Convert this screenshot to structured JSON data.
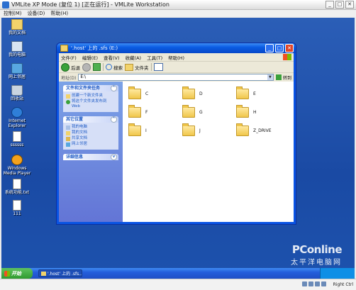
{
  "host": {
    "title": "VMLite XP Mode (复位 1) [正在运行] - VMLite Workstation",
    "menu": [
      "控制(M)",
      "设备(D)",
      "帮助(H)"
    ],
    "controls": [
      "_",
      "□",
      "✕"
    ],
    "status_text": "Right Ctrl"
  },
  "desktop_icons": [
    {
      "label": "我的文档",
      "icon": "my-documents-icon"
    },
    {
      "label": "我的电脑",
      "icon": "my-computer-icon"
    },
    {
      "label": "网上邻居",
      "icon": "network-places-icon"
    },
    {
      "label": "回收站",
      "icon": "recycle-bin-icon"
    },
    {
      "label": "Internet Explorer",
      "icon": "internet-explorer-icon"
    },
    {
      "label": "ssssss",
      "icon": "file-icon"
    },
    {
      "label": "Windows Media Player",
      "icon": "media-player-icon"
    },
    {
      "label": "系统功能.txt",
      "icon": "text-file-icon"
    },
    {
      "label": "111",
      "icon": "file-icon"
    }
  ],
  "explorer": {
    "title": "'.host' 上的 .sfs (E:)",
    "title_buttons": [
      "_",
      "□",
      "✕"
    ],
    "menu": [
      "文件(F)",
      "编辑(E)",
      "查看(V)",
      "收藏(A)",
      "工具(T)",
      "帮助(H)"
    ],
    "toolbar": {
      "back": "后退",
      "search": "搜索",
      "folders": "文件夹"
    },
    "address_label": "地址(D)",
    "address_value": "E:\\",
    "go_label": "转到",
    "panels": {
      "file_tasks": {
        "title": "文件和文件夹任务",
        "items": [
          "创建一个新文件夹",
          "将这个文件夹发布到 Web"
        ]
      },
      "other_places": {
        "title": "其它位置",
        "items": [
          "我的电脑",
          "我的文档",
          "共享文档",
          "网上邻居"
        ]
      },
      "details": {
        "title": "详细信息"
      }
    },
    "folders": [
      "C",
      "D",
      "E",
      "F",
      "G",
      "H",
      "I",
      "J",
      "Z_DRIVE"
    ]
  },
  "taskbar": {
    "start_label": "开始",
    "task_label": "'.host' 上的 .sfs..."
  },
  "watermark": {
    "line1": "PConline",
    "line2": "太平洋电脑网"
  }
}
